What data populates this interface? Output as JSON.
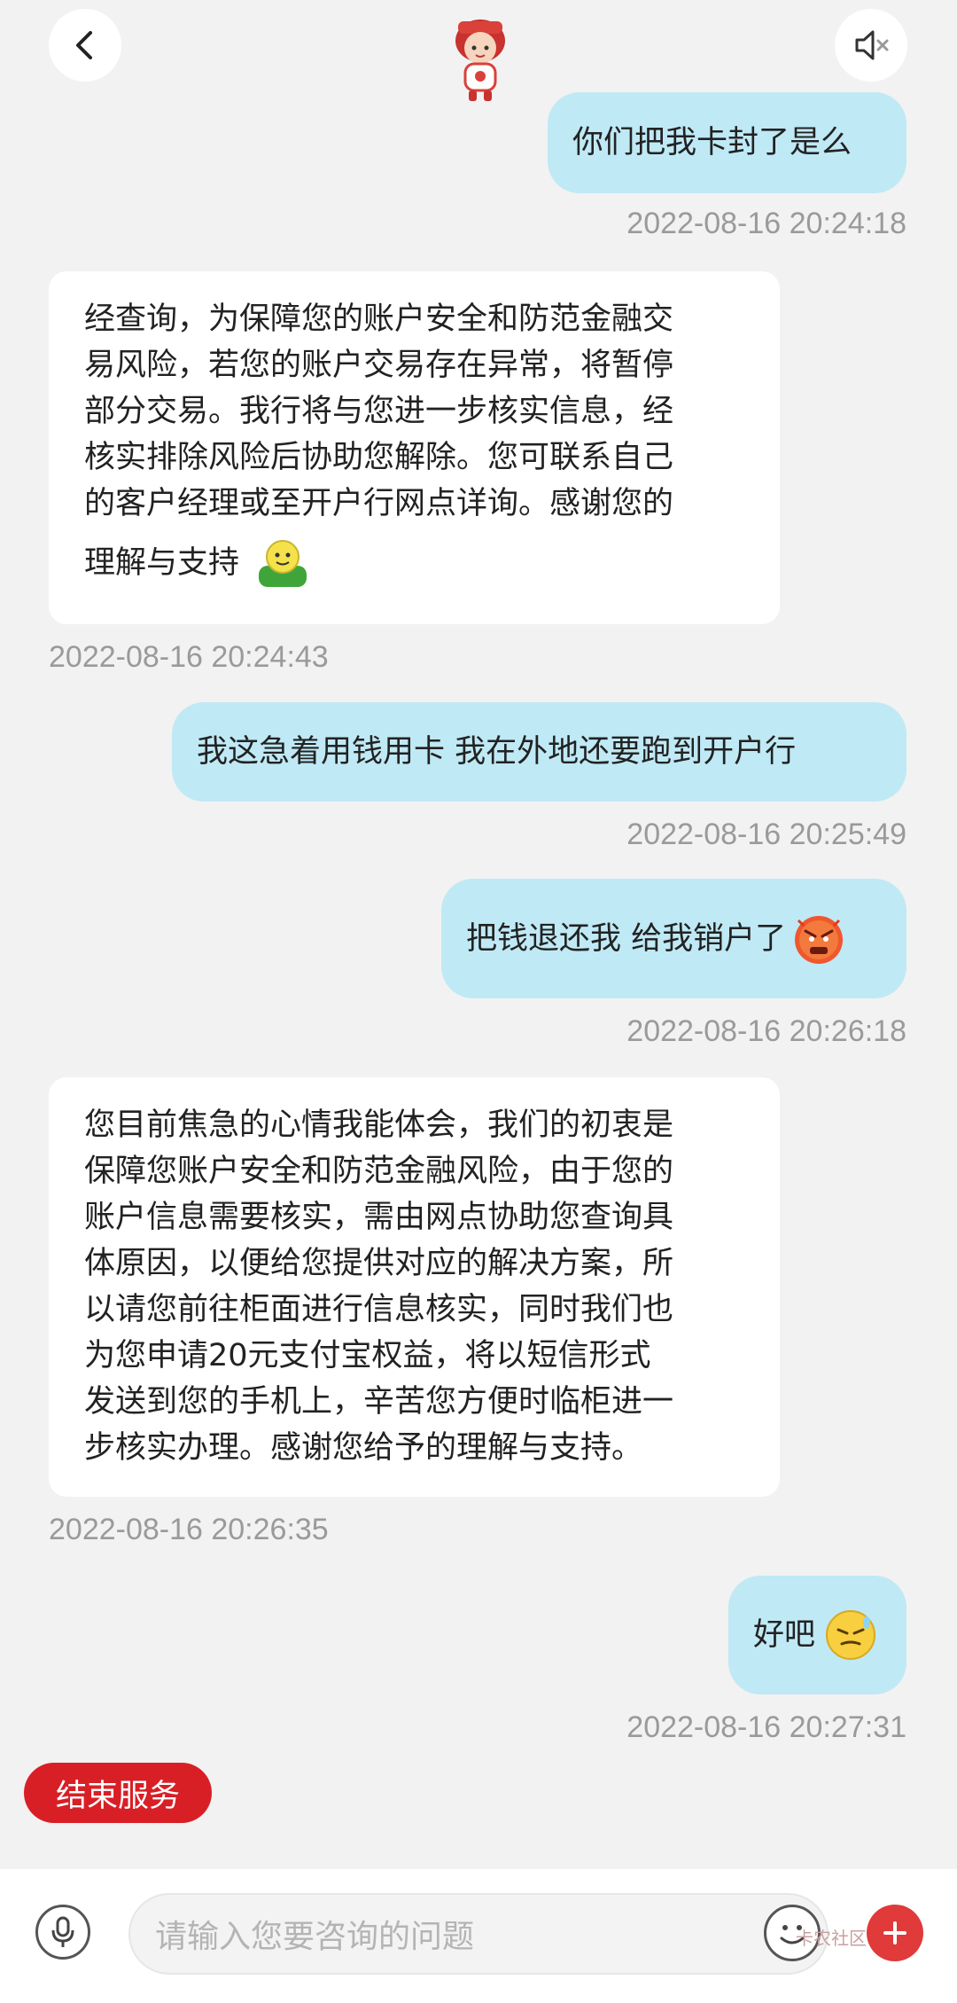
{
  "header": {
    "back_icon": "chevron-left-icon",
    "sound_icon": "speaker-muted-icon",
    "avatar_icon": "mascot-avatar"
  },
  "messages": [
    {
      "side": "out",
      "text": "你们把我卡封了是么",
      "time": "2022-08-16 20:24:18"
    },
    {
      "side": "in",
      "lines": [
        "经查询，为保障您的账户安全和防范金融交",
        "易风险，若您的账户交易存在异常，将暂停",
        "部分交易。我行将与您进一步核实信息，经",
        "核实排除风险后协助您解除。您可联系自己",
        "的客户经理或至开户行网点详询。感谢您的",
        "理解与支持"
      ],
      "emoji": "smile-emoji",
      "time": "2022-08-16 20:24:43"
    },
    {
      "side": "out",
      "text": "我这急着用钱用卡 我在外地还要跑到开户行",
      "time": "2022-08-16 20:25:49"
    },
    {
      "side": "out",
      "text": "把钱退还我 给我销户了",
      "emoji": "angry-emoji",
      "time": "2022-08-16 20:26:18"
    },
    {
      "side": "in",
      "lines": [
        "您目前焦急的心情我能体会，我们的初衷是",
        "保障您账户安全和防范金融风险，由于您的",
        "账户信息需要核实，需由网点协助您查询具",
        "体原因，以便给您提供对应的解决方案，所",
        "以请您前往柜面进行信息核实，同时我们也",
        "为您申请20元支付宝权益，将以短信形式",
        "发送到您的手机上，辛苦您方便时临柜进一",
        "步核实办理。感谢您给予的理解与支持。"
      ],
      "time": "2022-08-16 20:26:35"
    },
    {
      "side": "out",
      "text": "好吧",
      "emoji": "sweat-emoji",
      "time": "2022-08-16 20:27:31"
    }
  ],
  "end_button": {
    "label": "结束服务"
  },
  "input": {
    "placeholder": "请输入您要咨询的问题"
  },
  "watermark": {
    "text": "卡农社区"
  },
  "colors": {
    "outgoing_bubble": "#bfe9f5",
    "incoming_bubble": "#ffffff",
    "accent_red": "#d81f26",
    "background": "#f2f2f2"
  }
}
